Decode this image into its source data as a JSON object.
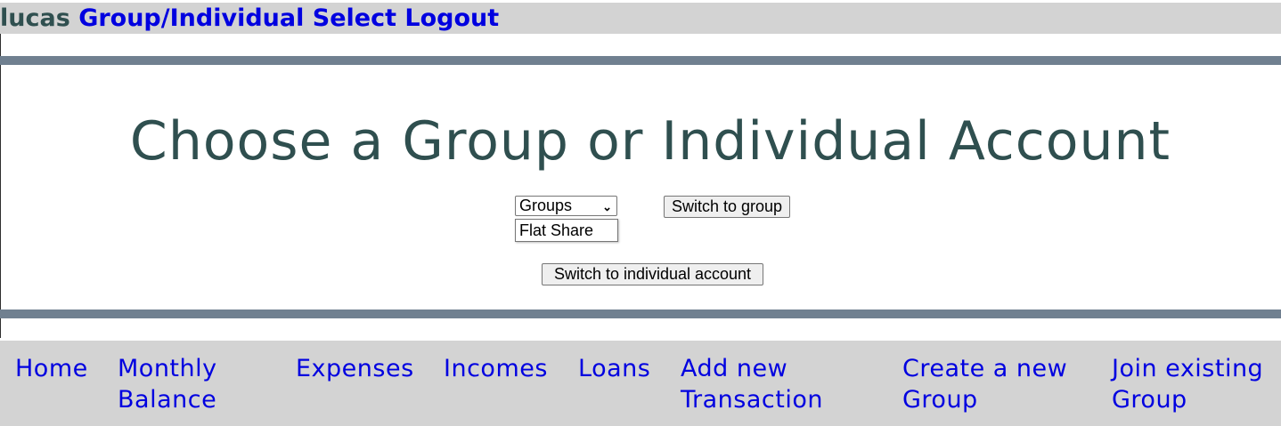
{
  "topbar": {
    "username": "lucas",
    "group_select_link": "Group/Individual Select",
    "logout_link": "Logout"
  },
  "main": {
    "title": "Choose a Group or Individual Account",
    "group_select": {
      "selected": "Groups",
      "options": [
        "Flat Share"
      ]
    },
    "switch_group_button": "Switch to group",
    "switch_individual_button": "Switch to individual account"
  },
  "bottom_nav": {
    "items": [
      {
        "line1": "Home",
        "line2": ""
      },
      {
        "line1": "Monthly",
        "line2": "Balance"
      },
      {
        "line1": "Expenses",
        "line2": ""
      },
      {
        "line1": "Incomes",
        "line2": ""
      },
      {
        "line1": "Loans",
        "line2": ""
      },
      {
        "line1": "Add new",
        "line2": "Transaction"
      },
      {
        "line1": "Create a new",
        "line2": "Group"
      },
      {
        "line1": "Join existing",
        "line2": "Group"
      }
    ]
  },
  "colors": {
    "link": "#0000e0",
    "heading": "#2f4f4f",
    "bar_background": "#d3d3d3",
    "separator": "#708090"
  }
}
